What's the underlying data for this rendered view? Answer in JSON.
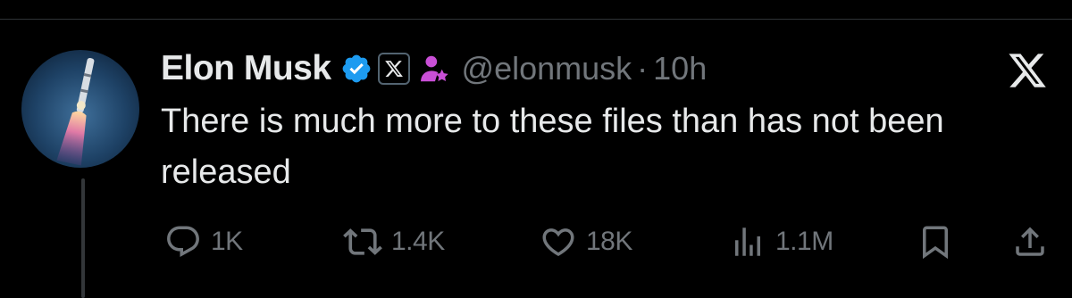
{
  "tweet": {
    "author_name": "Elon Musk",
    "handle": "@elonmusk",
    "separator": "·",
    "time": "10h",
    "text": "There is much more to these files than has not been released"
  },
  "badges": {
    "verified_icon": "verified-badge-icon",
    "affiliation_icon": "x-affiliation-icon",
    "government_icon": "government-person-icon",
    "verified_color": "#1d9bf0",
    "government_color": "#c94fd6"
  },
  "actions": {
    "reply": {
      "count": "1K",
      "icon": "reply-icon"
    },
    "repost": {
      "count": "1.4K",
      "icon": "repost-icon"
    },
    "like": {
      "count": "18K",
      "icon": "heart-icon"
    },
    "views": {
      "count": "1.1M",
      "icon": "views-icon"
    },
    "bookmark": {
      "icon": "bookmark-icon"
    },
    "share": {
      "icon": "share-icon"
    }
  },
  "theme": {
    "background": "#000000",
    "primary_text": "#e7e9ea",
    "secondary_text": "#71767b"
  }
}
